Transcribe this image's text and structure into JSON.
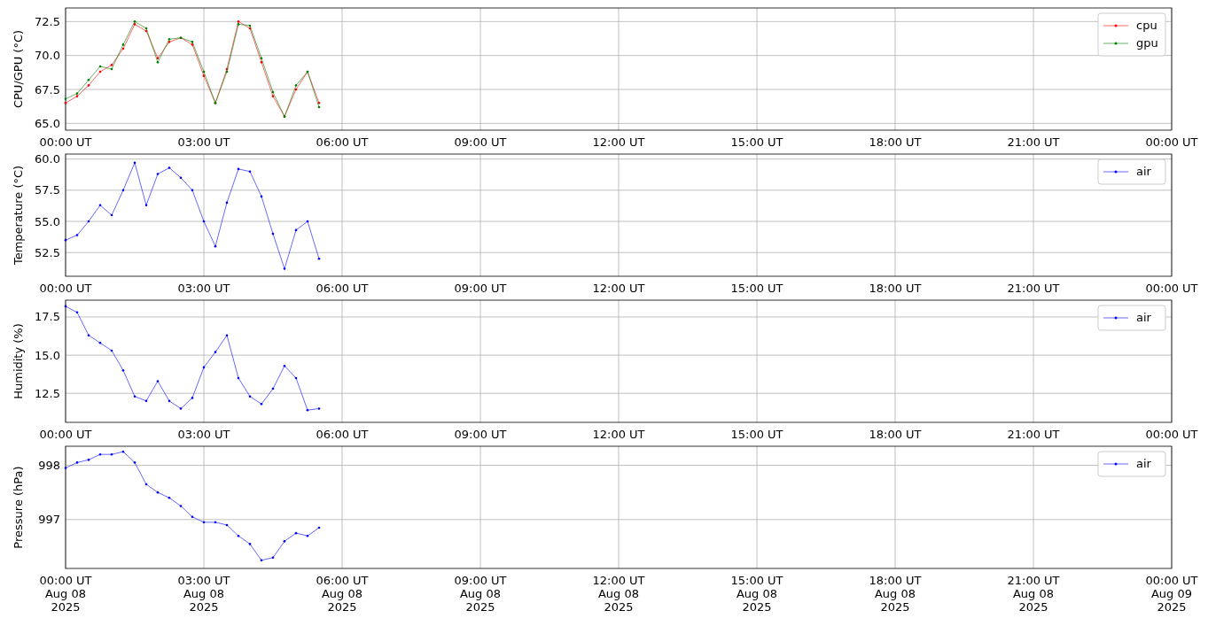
{
  "panels": [
    {
      "chart_data": {
        "type": "line",
        "grid": true,
        "legend": "upper right",
        "ylabel": "CPU/GPU (°C)",
        "ylim": [
          64.5,
          73.5
        ],
        "categories": [
          "00:00 UT",
          null,
          null,
          null,
          null,
          null,
          null,
          null,
          null,
          null,
          null,
          null,
          "03:00 UT",
          null,
          null,
          null,
          null,
          null,
          null,
          null,
          null,
          null,
          null,
          null,
          "06:00 UT",
          null,
          null,
          null,
          null,
          null,
          null,
          null,
          null,
          null,
          null,
          null,
          "09:00 UT",
          null,
          null,
          null,
          null,
          null,
          null,
          null,
          null,
          null,
          null,
          null,
          "12:00 UT",
          null,
          null,
          null,
          null,
          null,
          null,
          null,
          null,
          null,
          null,
          null,
          "15:00 UT",
          null,
          null,
          null,
          null,
          null,
          null,
          null,
          null,
          null,
          null,
          null,
          "18:00 UT",
          null,
          null,
          null,
          null,
          null,
          null,
          null,
          null,
          null,
          null,
          null,
          "21:00 UT",
          null,
          null,
          null,
          null,
          null,
          null,
          null,
          null,
          null,
          null,
          null,
          "00:00 UT"
        ],
        "yticks": [
          {
            "value": 65,
            "label": "65.0"
          },
          {
            "value": 67.5,
            "label": "67.5"
          },
          {
            "value": 70,
            "label": "70.0"
          },
          {
            "value": 72.5,
            "label": "72.5"
          }
        ],
        "series": [
          {
            "name": "cpu",
            "color": "#ff0000",
            "values": [
              66.5,
              67.0,
              67.8,
              68.8,
              69.3,
              70.5,
              72.3,
              71.8,
              69.8,
              71.0,
              71.3,
              70.8,
              68.5,
              66.5,
              69.0,
              72.5,
              72.0,
              69.5,
              67.0,
              65.5,
              67.5,
              68.8,
              66.5,
              null,
              null,
              null,
              null,
              null,
              null,
              null,
              null,
              null,
              null,
              null,
              null,
              null,
              null,
              null,
              null,
              null,
              null,
              null,
              null,
              null,
              null,
              null,
              null,
              null,
              null,
              null,
              null,
              null,
              null,
              null,
              null,
              null,
              null,
              null,
              null,
              null,
              null,
              null,
              null,
              null,
              null,
              null,
              null,
              null,
              null,
              null,
              null,
              null,
              null,
              null,
              null,
              null,
              null,
              null,
              null,
              null,
              null,
              null,
              null,
              null,
              null,
              null,
              null,
              null,
              null,
              null,
              null,
              null,
              null,
              null,
              null,
              null,
              null
            ]
          },
          {
            "name": "gpu",
            "color": "#008000",
            "values": [
              66.8,
              67.2,
              68.2,
              69.2,
              69.0,
              70.8,
              72.5,
              72.0,
              69.5,
              71.2,
              71.3,
              71.0,
              68.8,
              66.5,
              68.8,
              72.3,
              72.2,
              69.8,
              67.3,
              65.5,
              67.8,
              68.8,
              66.2,
              null,
              null,
              null,
              null,
              null,
              null,
              null,
              null,
              null,
              null,
              null,
              null,
              null,
              null,
              null,
              null,
              null,
              null,
              null,
              null,
              null,
              null,
              null,
              null,
              null,
              null,
              null,
              null,
              null,
              null,
              null,
              null,
              null,
              null,
              null,
              null,
              null,
              null,
              null,
              null,
              null,
              null,
              null,
              null,
              null,
              null,
              null,
              null,
              null,
              null,
              null,
              null,
              null,
              null,
              null,
              null,
              null,
              null,
              null,
              null,
              null,
              null,
              null,
              null,
              null,
              null,
              null,
              null,
              null,
              null,
              null,
              null,
              null,
              null
            ]
          }
        ]
      }
    },
    {
      "chart_data": {
        "type": "line",
        "grid": true,
        "legend": "upper right",
        "ylabel": "Temperature (°C)",
        "ylim": [
          50.6,
          60.4
        ],
        "categories": [
          "00:00 UT",
          null,
          null,
          null,
          null,
          null,
          null,
          null,
          null,
          null,
          null,
          null,
          "03:00 UT",
          null,
          null,
          null,
          null,
          null,
          null,
          null,
          null,
          null,
          null,
          null,
          "06:00 UT",
          null,
          null,
          null,
          null,
          null,
          null,
          null,
          null,
          null,
          null,
          null,
          "09:00 UT",
          null,
          null,
          null,
          null,
          null,
          null,
          null,
          null,
          null,
          null,
          null,
          "12:00 UT",
          null,
          null,
          null,
          null,
          null,
          null,
          null,
          null,
          null,
          null,
          null,
          "15:00 UT",
          null,
          null,
          null,
          null,
          null,
          null,
          null,
          null,
          null,
          null,
          null,
          "18:00 UT",
          null,
          null,
          null,
          null,
          null,
          null,
          null,
          null,
          null,
          null,
          null,
          "21:00 UT",
          null,
          null,
          null,
          null,
          null,
          null,
          null,
          null,
          null,
          null,
          null,
          "00:00 UT"
        ],
        "yticks": [
          {
            "value": 52.5,
            "label": "52.5"
          },
          {
            "value": 55,
            "label": "55.0"
          },
          {
            "value": 57.5,
            "label": "57.5"
          },
          {
            "value": 60,
            "label": "60.0"
          }
        ],
        "series": [
          {
            "name": "air",
            "color": "#0000ff",
            "values": [
              53.5,
              53.9,
              55.0,
              56.3,
              55.5,
              57.5,
              59.7,
              56.3,
              58.8,
              59.3,
              58.5,
              57.5,
              55.0,
              53.0,
              56.5,
              59.2,
              59.0,
              57.0,
              54.0,
              51.2,
              54.3,
              55.0,
              52.0,
              null,
              null,
              null,
              null,
              null,
              null,
              null,
              null,
              null,
              null,
              null,
              null,
              null,
              null,
              null,
              null,
              null,
              null,
              null,
              null,
              null,
              null,
              null,
              null,
              null,
              null,
              null,
              null,
              null,
              null,
              null,
              null,
              null,
              null,
              null,
              null,
              null,
              null,
              null,
              null,
              null,
              null,
              null,
              null,
              null,
              null,
              null,
              null,
              null,
              null,
              null,
              null,
              null,
              null,
              null,
              null,
              null,
              null,
              null,
              null,
              null,
              null,
              null,
              null,
              null,
              null,
              null,
              null,
              null,
              null,
              null,
              null,
              null,
              null
            ]
          }
        ]
      }
    },
    {
      "chart_data": {
        "type": "line",
        "grid": true,
        "legend": "upper right",
        "ylabel": "Humidity (%)",
        "ylim": [
          10.6,
          18.6
        ],
        "categories": [
          "00:00 UT",
          null,
          null,
          null,
          null,
          null,
          null,
          null,
          null,
          null,
          null,
          null,
          "03:00 UT",
          null,
          null,
          null,
          null,
          null,
          null,
          null,
          null,
          null,
          null,
          null,
          "06:00 UT",
          null,
          null,
          null,
          null,
          null,
          null,
          null,
          null,
          null,
          null,
          null,
          "09:00 UT",
          null,
          null,
          null,
          null,
          null,
          null,
          null,
          null,
          null,
          null,
          null,
          "12:00 UT",
          null,
          null,
          null,
          null,
          null,
          null,
          null,
          null,
          null,
          null,
          null,
          "15:00 UT",
          null,
          null,
          null,
          null,
          null,
          null,
          null,
          null,
          null,
          null,
          null,
          "18:00 UT",
          null,
          null,
          null,
          null,
          null,
          null,
          null,
          null,
          null,
          null,
          null,
          "21:00 UT",
          null,
          null,
          null,
          null,
          null,
          null,
          null,
          null,
          null,
          null,
          null,
          "00:00 UT"
        ],
        "yticks": [
          {
            "value": 12.5,
            "label": "12.5"
          },
          {
            "value": 15,
            "label": "15.0"
          },
          {
            "value": 17.5,
            "label": "17.5"
          }
        ],
        "series": [
          {
            "name": "air",
            "color": "#0000ff",
            "values": [
              18.2,
              17.8,
              16.3,
              15.8,
              15.3,
              14.0,
              12.3,
              12.0,
              13.3,
              12.0,
              11.5,
              12.2,
              14.2,
              15.2,
              16.3,
              13.5,
              12.3,
              11.8,
              12.8,
              14.3,
              13.5,
              11.4,
              11.5,
              null,
              null,
              null,
              null,
              null,
              null,
              null,
              null,
              null,
              null,
              null,
              null,
              null,
              null,
              null,
              null,
              null,
              null,
              null,
              null,
              null,
              null,
              null,
              null,
              null,
              null,
              null,
              null,
              null,
              null,
              null,
              null,
              null,
              null,
              null,
              null,
              null,
              null,
              null,
              null,
              null,
              null,
              null,
              null,
              null,
              null,
              null,
              null,
              null,
              null,
              null,
              null,
              null,
              null,
              null,
              null,
              null,
              null,
              null,
              null,
              null,
              null,
              null,
              null,
              null,
              null,
              null,
              null,
              null,
              null,
              null,
              null,
              null,
              null
            ]
          }
        ]
      }
    },
    {
      "chart_data": {
        "type": "line",
        "grid": true,
        "legend": "upper right",
        "ylabel": "Pressure (hPa)",
        "ylim": [
          996.1,
          998.35
        ],
        "categories": [
          "00:00 UT\nAug 08\n2025",
          null,
          null,
          null,
          null,
          null,
          null,
          null,
          null,
          null,
          null,
          null,
          "03:00 UT\nAug 08\n2025",
          null,
          null,
          null,
          null,
          null,
          null,
          null,
          null,
          null,
          null,
          null,
          "06:00 UT\nAug 08\n2025",
          null,
          null,
          null,
          null,
          null,
          null,
          null,
          null,
          null,
          null,
          null,
          "09:00 UT\nAug 08\n2025",
          null,
          null,
          null,
          null,
          null,
          null,
          null,
          null,
          null,
          null,
          null,
          "12:00 UT\nAug 08\n2025",
          null,
          null,
          null,
          null,
          null,
          null,
          null,
          null,
          null,
          null,
          null,
          "15:00 UT\nAug 08\n2025",
          null,
          null,
          null,
          null,
          null,
          null,
          null,
          null,
          null,
          null,
          null,
          "18:00 UT\nAug 08\n2025",
          null,
          null,
          null,
          null,
          null,
          null,
          null,
          null,
          null,
          null,
          null,
          "21:00 UT\nAug 08\n2025",
          null,
          null,
          null,
          null,
          null,
          null,
          null,
          null,
          null,
          null,
          null,
          "00:00 UT\nAug 09\n2025"
        ],
        "yticks": [
          {
            "value": 997,
            "label": "997"
          },
          {
            "value": 998,
            "label": "998"
          }
        ],
        "series": [
          {
            "name": "air",
            "color": "#0000ff",
            "values": [
              997.95,
              998.05,
              998.1,
              998.2,
              998.2,
              998.25,
              998.05,
              997.65,
              997.5,
              997.4,
              997.25,
              997.05,
              996.95,
              996.95,
              996.9,
              996.7,
              996.55,
              996.25,
              996.3,
              996.6,
              996.75,
              996.7,
              996.85,
              null,
              null,
              null,
              null,
              null,
              null,
              null,
              null,
              null,
              null,
              null,
              null,
              null,
              null,
              null,
              null,
              null,
              null,
              null,
              null,
              null,
              null,
              null,
              null,
              null,
              null,
              null,
              null,
              null,
              null,
              null,
              null,
              null,
              null,
              null,
              null,
              null,
              null,
              null,
              null,
              null,
              null,
              null,
              null,
              null,
              null,
              null,
              null,
              null,
              null,
              null,
              null,
              null,
              null,
              null,
              null,
              null,
              null,
              null,
              null,
              null,
              null,
              null,
              null,
              null,
              null,
              null,
              null,
              null,
              null,
              null,
              null,
              null,
              null
            ]
          }
        ]
      }
    }
  ]
}
